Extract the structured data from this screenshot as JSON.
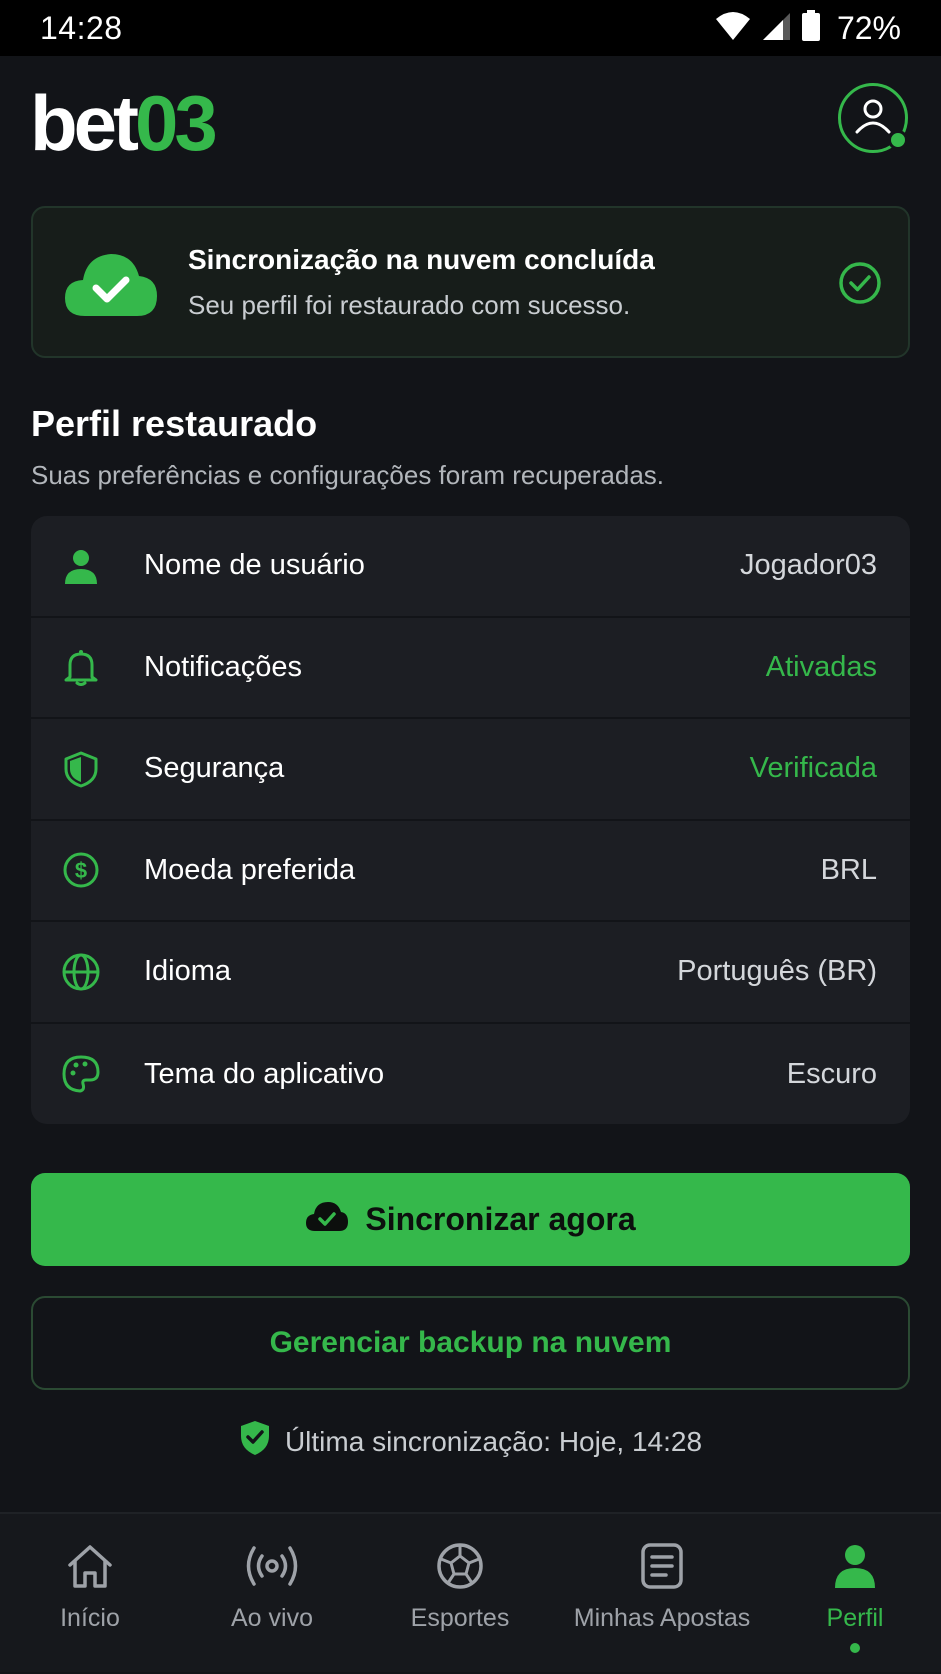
{
  "status_bar": {
    "time": "14:28",
    "battery_percent": "72%",
    "icons": [
      "wifi-icon",
      "signal-icon",
      "battery-icon"
    ]
  },
  "header": {
    "logo_part1": "bet",
    "logo_part2": "03",
    "profile_icon": "user-circle-icon"
  },
  "sync_card": {
    "title": "Sincronização na nuvem concluída",
    "subtitle": "Seu perfil foi restaurado com sucesso.",
    "icon": "cloud-check-icon",
    "status_icon": "check-circle-icon"
  },
  "section": {
    "title": "Perfil restaurado",
    "subtitle": "Suas preferências e configurações foram recuperadas."
  },
  "settings": [
    {
      "icon": "user-icon",
      "label": "Nome de usuário",
      "value": "Jogador03",
      "highlight": false
    },
    {
      "icon": "bell-icon",
      "label": "Notificações",
      "value": "Ativadas",
      "highlight": true
    },
    {
      "icon": "shield-icon",
      "label": "Segurança",
      "value": "Verificada",
      "highlight": true
    },
    {
      "icon": "currency-icon",
      "label": "Moeda preferida",
      "value": "BRL",
      "highlight": false
    },
    {
      "icon": "globe-icon",
      "label": "Idioma",
      "value": "Português (BR)",
      "highlight": false
    },
    {
      "icon": "palette-icon",
      "label": "Tema do aplicativo",
      "value": "Escuro",
      "highlight": false
    }
  ],
  "actions": {
    "sync_now": "Sincronizar agora",
    "manage_backup": "Gerenciar backup na nuvem"
  },
  "last_sync": "Última sincronização: Hoje, 14:28",
  "bottom_nav": [
    {
      "icon": "home-icon",
      "label": "Início",
      "active": false
    },
    {
      "icon": "live-icon",
      "label": "Ao vivo",
      "active": false
    },
    {
      "icon": "soccer-ball-icon",
      "label": "Esportes",
      "active": false
    },
    {
      "icon": "bets-icon",
      "label": "Minhas Apostas",
      "active": false
    },
    {
      "icon": "profile-icon",
      "label": "Perfil",
      "active": true
    }
  ],
  "colors": {
    "accent": "#35b84b",
    "background": "#121418",
    "card": "#1c1e23"
  }
}
